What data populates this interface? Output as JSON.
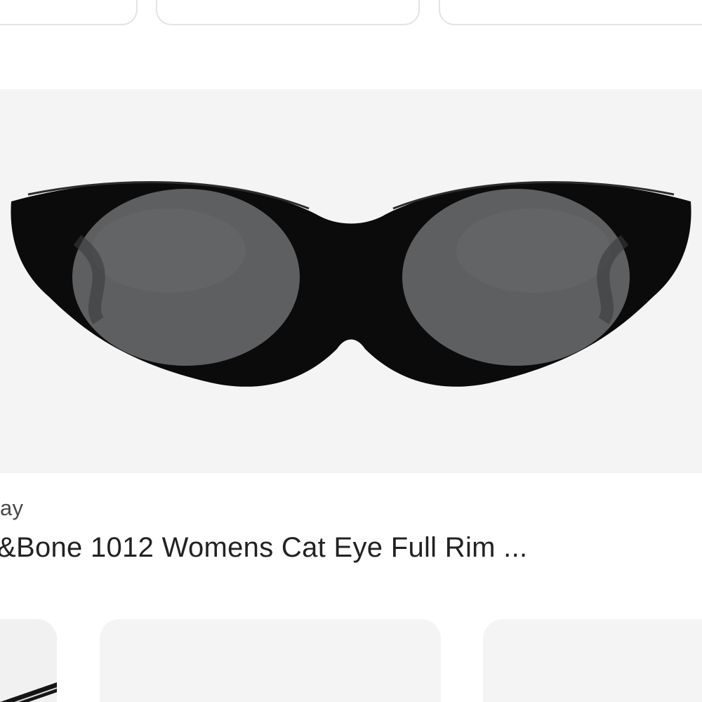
{
  "result": {
    "source": "ay",
    "title": "&Bone 1012 Womens Cat Eye Full Rim ..."
  },
  "colors": {
    "panel_background": "#f4f4f4",
    "frame": "#0b0b0b",
    "lens": "#5f6062",
    "border": "#e3e3e3"
  },
  "icons": {
    "product_image": "cat-eye-sunglasses"
  }
}
